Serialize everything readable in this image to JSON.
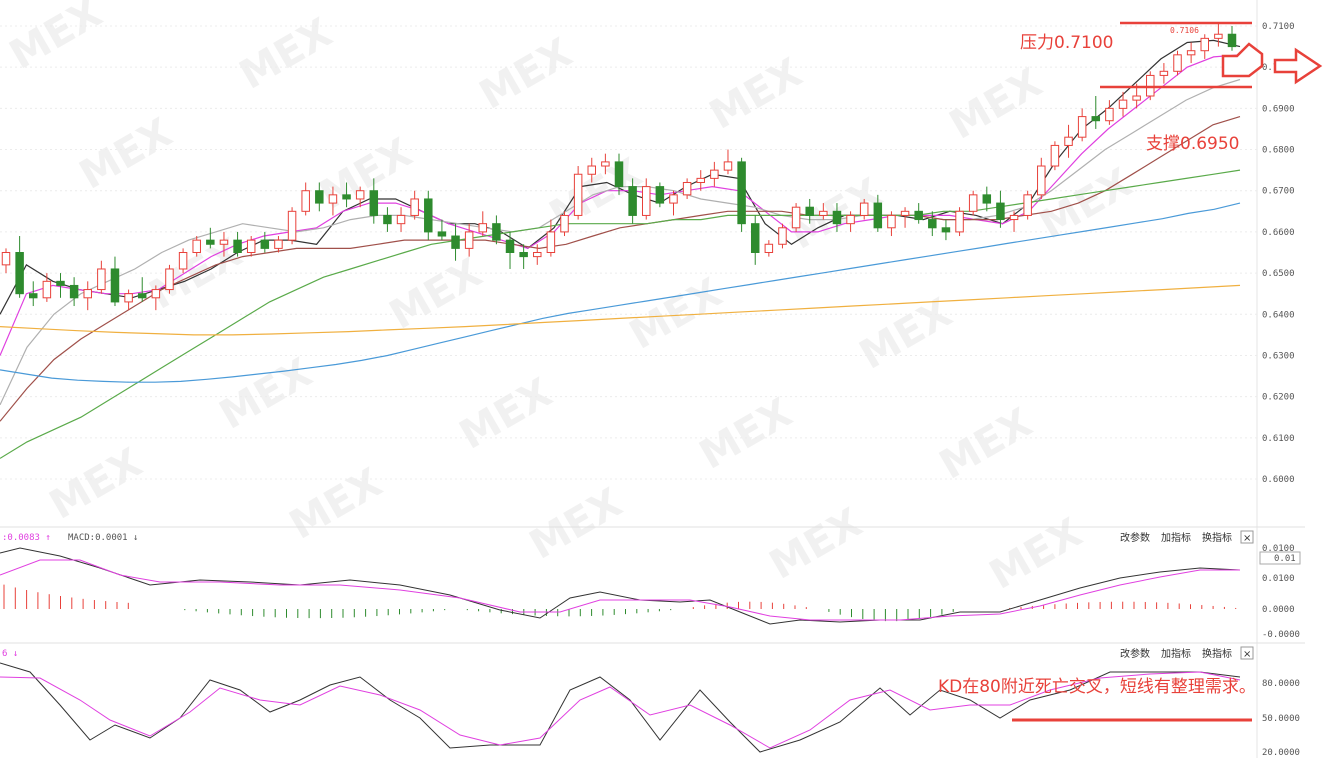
{
  "annotations": {
    "resistance": "压力0.7100",
    "support": "支撑0.6950",
    "kd_note": "KD在80附近死亡交叉，短线有整理需求。",
    "last_price": "0.7106"
  },
  "watermark": "MEX",
  "macd_panel": {
    "header_left": ":0.0083 ↑",
    "header_macd": "MACD:0.0001 ↓",
    "buttons": [
      "改参数",
      "加指标",
      "换指标"
    ],
    "close_label": "×",
    "current_value": "0.01"
  },
  "kd_panel": {
    "header_left": "6 ↓",
    "buttons": [
      "改参数",
      "加指标",
      "换指标"
    ],
    "close_label": "×"
  },
  "colors": {
    "up": "#e8413a",
    "down": "#2e8b2e",
    "ma_black": "#333333",
    "ma_pink": "#e040e0",
    "ma_gray": "#b0b0b0",
    "ma_brown": "#a0504a",
    "ma_green": "#5aaa4a",
    "ma_blue": "#4a9ad8",
    "ma_orange": "#f0b040",
    "annot": "#e8413a"
  },
  "chart_data": [
    {
      "type": "candlestick",
      "ylim": [
        0.59,
        0.715
      ],
      "yticks": [
        "0.7100",
        "0.7000",
        "0.6900",
        "0.6800",
        "0.6700",
        "0.6600",
        "0.6500",
        "0.6400",
        "0.6300",
        "0.6200",
        "0.6100",
        "0.6000"
      ],
      "ohlc": [
        [
          0.652,
          0.656,
          0.65,
          0.655
        ],
        [
          0.655,
          0.659,
          0.644,
          0.645
        ],
        [
          0.645,
          0.648,
          0.642,
          0.644
        ],
        [
          0.644,
          0.65,
          0.643,
          0.648
        ],
        [
          0.648,
          0.65,
          0.644,
          0.647
        ],
        [
          0.647,
          0.649,
          0.642,
          0.644
        ],
        [
          0.644,
          0.648,
          0.641,
          0.646
        ],
        [
          0.646,
          0.653,
          0.645,
          0.651
        ],
        [
          0.651,
          0.654,
          0.642,
          0.643
        ],
        [
          0.643,
          0.646,
          0.641,
          0.645
        ],
        [
          0.645,
          0.649,
          0.643,
          0.644
        ],
        [
          0.644,
          0.647,
          0.641,
          0.646
        ],
        [
          0.646,
          0.652,
          0.645,
          0.651
        ],
        [
          0.651,
          0.656,
          0.65,
          0.655
        ],
        [
          0.655,
          0.659,
          0.654,
          0.658
        ],
        [
          0.658,
          0.661,
          0.656,
          0.657
        ],
        [
          0.657,
          0.66,
          0.654,
          0.658
        ],
        [
          0.658,
          0.66,
          0.654,
          0.655
        ],
        [
          0.655,
          0.659,
          0.654,
          0.658
        ],
        [
          0.658,
          0.66,
          0.655,
          0.656
        ],
        [
          0.656,
          0.659,
          0.655,
          0.658
        ],
        [
          0.658,
          0.666,
          0.657,
          0.665
        ],
        [
          0.665,
          0.672,
          0.664,
          0.67
        ],
        [
          0.67,
          0.672,
          0.665,
          0.667
        ],
        [
          0.667,
          0.671,
          0.664,
          0.669
        ],
        [
          0.669,
          0.672,
          0.666,
          0.668
        ],
        [
          0.668,
          0.671,
          0.666,
          0.67
        ],
        [
          0.67,
          0.673,
          0.662,
          0.664
        ],
        [
          0.664,
          0.666,
          0.66,
          0.662
        ],
        [
          0.662,
          0.666,
          0.66,
          0.664
        ],
        [
          0.664,
          0.67,
          0.663,
          0.668
        ],
        [
          0.668,
          0.67,
          0.658,
          0.66
        ],
        [
          0.66,
          0.663,
          0.658,
          0.659
        ],
        [
          0.659,
          0.662,
          0.653,
          0.656
        ],
        [
          0.656,
          0.662,
          0.654,
          0.66
        ],
        [
          0.66,
          0.665,
          0.659,
          0.662
        ],
        [
          0.662,
          0.664,
          0.657,
          0.658
        ],
        [
          0.658,
          0.66,
          0.651,
          0.655
        ],
        [
          0.655,
          0.657,
          0.651,
          0.654
        ],
        [
          0.654,
          0.657,
          0.652,
          0.655
        ],
        [
          0.655,
          0.663,
          0.654,
          0.66
        ],
        [
          0.66,
          0.665,
          0.659,
          0.664
        ],
        [
          0.664,
          0.676,
          0.663,
          0.674
        ],
        [
          0.674,
          0.678,
          0.672,
          0.676
        ],
        [
          0.676,
          0.679,
          0.674,
          0.677
        ],
        [
          0.677,
          0.679,
          0.669,
          0.671
        ],
        [
          0.671,
          0.673,
          0.662,
          0.664
        ],
        [
          0.664,
          0.673,
          0.663,
          0.671
        ],
        [
          0.671,
          0.672,
          0.666,
          0.667
        ],
        [
          0.667,
          0.67,
          0.664,
          0.669
        ],
        [
          0.669,
          0.673,
          0.668,
          0.672
        ],
        [
          0.672,
          0.675,
          0.67,
          0.673
        ],
        [
          0.673,
          0.677,
          0.671,
          0.675
        ],
        [
          0.675,
          0.68,
          0.674,
          0.677
        ],
        [
          0.677,
          0.678,
          0.66,
          0.662
        ],
        [
          0.662,
          0.664,
          0.652,
          0.655
        ],
        [
          0.655,
          0.658,
          0.654,
          0.657
        ],
        [
          0.657,
          0.662,
          0.656,
          0.661
        ],
        [
          0.661,
          0.667,
          0.66,
          0.666
        ],
        [
          0.666,
          0.668,
          0.662,
          0.664
        ],
        [
          0.664,
          0.667,
          0.663,
          0.665
        ],
        [
          0.665,
          0.667,
          0.66,
          0.662
        ],
        [
          0.662,
          0.665,
          0.66,
          0.664
        ],
        [
          0.664,
          0.668,
          0.663,
          0.667
        ],
        [
          0.667,
          0.669,
          0.66,
          0.661
        ],
        [
          0.661,
          0.665,
          0.659,
          0.664
        ],
        [
          0.664,
          0.666,
          0.661,
          0.665
        ],
        [
          0.665,
          0.667,
          0.662,
          0.663
        ],
        [
          0.663,
          0.665,
          0.659,
          0.661
        ],
        [
          0.661,
          0.663,
          0.658,
          0.66
        ],
        [
          0.66,
          0.666,
          0.659,
          0.665
        ],
        [
          0.665,
          0.67,
          0.664,
          0.669
        ],
        [
          0.669,
          0.671,
          0.665,
          0.667
        ],
        [
          0.667,
          0.67,
          0.661,
          0.663
        ],
        [
          0.663,
          0.665,
          0.66,
          0.664
        ],
        [
          0.664,
          0.67,
          0.663,
          0.669
        ],
        [
          0.669,
          0.678,
          0.668,
          0.676
        ],
        [
          0.676,
          0.682,
          0.675,
          0.681
        ],
        [
          0.681,
          0.686,
          0.678,
          0.683
        ],
        [
          0.683,
          0.69,
          0.682,
          0.688
        ],
        [
          0.688,
          0.693,
          0.685,
          0.687
        ],
        [
          0.687,
          0.692,
          0.686,
          0.69
        ],
        [
          0.69,
          0.694,
          0.688,
          0.692
        ],
        [
          0.692,
          0.696,
          0.69,
          0.693
        ],
        [
          0.693,
          0.699,
          0.692,
          0.698
        ],
        [
          0.698,
          0.701,
          0.696,
          0.699
        ],
        [
          0.699,
          0.704,
          0.698,
          0.703
        ],
        [
          0.703,
          0.706,
          0.701,
          0.704
        ],
        [
          0.704,
          0.708,
          0.702,
          0.707
        ],
        [
          0.707,
          0.7106,
          0.705,
          0.708
        ],
        [
          0.708,
          0.71,
          0.704,
          0.705
        ]
      ],
      "ma": [
        {
          "color": "ma_black",
          "values": [
            0.64,
            0.652,
            0.648,
            0.646,
            0.645,
            0.644,
            0.646,
            0.648,
            0.651,
            0.655,
            0.658,
            0.658,
            0.657,
            0.665,
            0.668,
            0.668,
            0.665,
            0.662,
            0.662,
            0.66,
            0.656,
            0.661,
            0.671,
            0.672,
            0.669,
            0.667,
            0.671,
            0.674,
            0.673,
            0.662,
            0.657,
            0.661,
            0.664,
            0.664,
            0.664,
            0.663,
            0.665,
            0.664,
            0.662,
            0.667,
            0.677,
            0.685,
            0.69,
            0.696,
            0.702,
            0.706,
            0.7065,
            0.705
          ]
        },
        {
          "color": "ma_pink",
          "values": [
            0.63,
            0.645,
            0.647,
            0.646,
            0.645,
            0.645,
            0.646,
            0.65,
            0.654,
            0.657,
            0.659,
            0.66,
            0.661,
            0.665,
            0.667,
            0.667,
            0.665,
            0.662,
            0.66,
            0.658,
            0.656,
            0.66,
            0.667,
            0.67,
            0.67,
            0.669,
            0.67,
            0.671,
            0.67,
            0.665,
            0.66,
            0.66,
            0.662,
            0.663,
            0.664,
            0.664,
            0.664,
            0.663,
            0.662,
            0.665,
            0.672,
            0.679,
            0.685,
            0.69,
            0.695,
            0.7,
            0.7025,
            0.703
          ]
        }
      ]
    },
    {
      "type": "line",
      "name": "MACD",
      "ylim": [
        -0.001,
        0.01
      ],
      "yticks": [
        "0.0100",
        "0.0100",
        "0.0000",
        "-0.0000"
      ]
    },
    {
      "type": "line",
      "name": "KD",
      "ylim": [
        10,
        100
      ],
      "yticks": [
        "80.0000",
        "50.0000",
        "20.0000"
      ]
    }
  ]
}
